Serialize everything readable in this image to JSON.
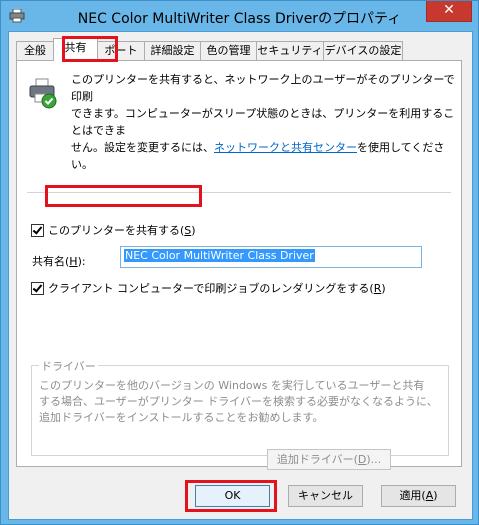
{
  "window": {
    "title": "NEC Color MultiWriter Class Driverのプロパティ",
    "close_label": "✕"
  },
  "tabs": [
    "全般",
    "共有",
    "ポート",
    "詳細設定",
    "色の管理",
    "セキュリティ",
    "デバイスの設定"
  ],
  "sharing": {
    "description_line1": "このプリンターを共有すると、ネットワーク上のユーザーがそのプリンターで印刷",
    "description_line2": "できます。コンピューターがスリープ状態のときは、プリンターを利用することはできま",
    "description_line3_pre": "せん。設定を変更するには、",
    "description_link": "ネットワークと共有センター",
    "description_line3_post": "を使用してください。",
    "share_checkbox_label": "このプリンターを共有する(",
    "share_checkbox_key": "S",
    "share_checkbox_end": ")",
    "share_checked": true,
    "share_name_label": "共有名(",
    "share_name_key": "H",
    "share_name_end": "):",
    "share_name_value": "NEC Color MultiWriter Class Driver",
    "render_checkbox_label": "クライアント コンピューターで印刷ジョブのレンダリングをする(",
    "render_checkbox_key": "R",
    "render_checkbox_end": ")",
    "render_checked": true
  },
  "driver_group": {
    "title": "ドライバー",
    "text_line1": "このプリンターを他のバージョンの Windows を実行しているユーザーと共有",
    "text_line2": "する場合、ユーザーがプリンター ドライバーを検索する必要がなくなるように、",
    "text_line3": "追加ドライバーをインストールすることをお勧めします。",
    "add_driver_label": "追加ドライバー(",
    "add_driver_key": "D",
    "add_driver_end": ")..."
  },
  "buttons": {
    "ok": "OK",
    "cancel": "キャンセル",
    "apply_label": "適用(",
    "apply_key": "A",
    "apply_end": ")"
  },
  "colors": {
    "titlebar": "#68b7e8",
    "highlight": "#e4121d",
    "link": "#0066cc",
    "close": "#c7392f"
  }
}
